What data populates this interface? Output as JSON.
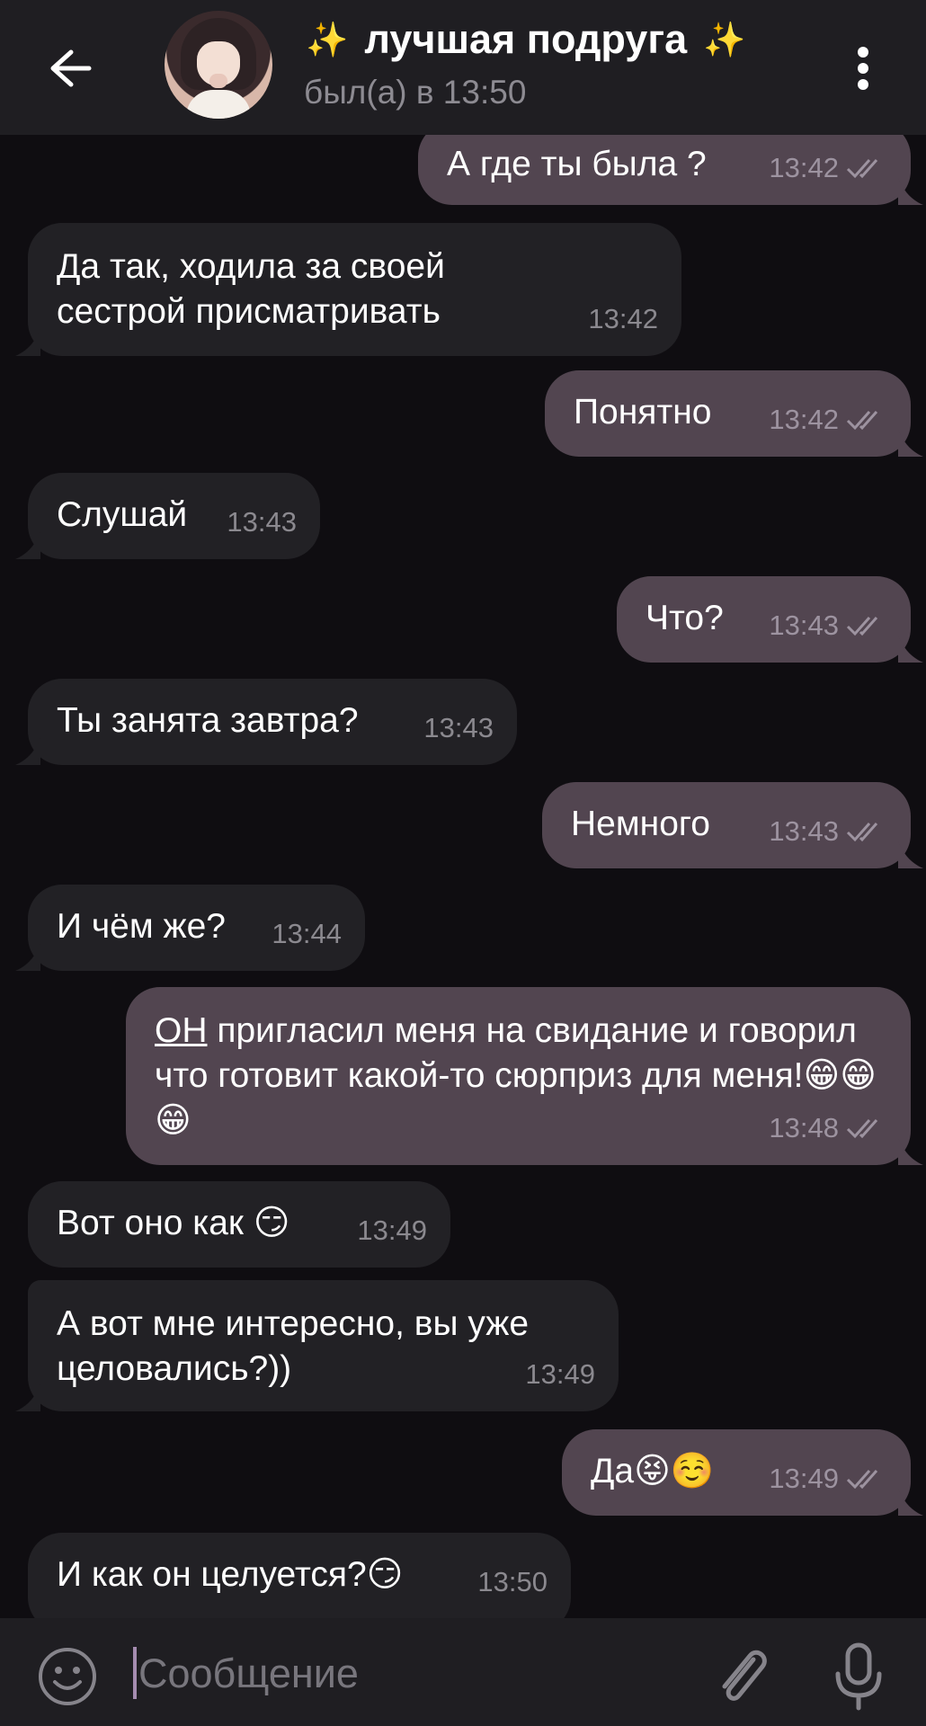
{
  "header": {
    "title": "лучшая подруга",
    "title_deco_left": "✨",
    "title_deco_right": "✨",
    "status": "был(а) в 13:50"
  },
  "messages": [
    {
      "dir": "out",
      "text": "А где ты была ?",
      "time": "13:42"
    },
    {
      "dir": "in",
      "text": "Да так, ходила за своей сестрой присматривать",
      "time": "13:42"
    },
    {
      "dir": "out",
      "text": "Понятно",
      "time": "13:42"
    },
    {
      "dir": "in",
      "text": "Слушай",
      "time": "13:43"
    },
    {
      "dir": "out",
      "text": "Что?",
      "time": "13:43"
    },
    {
      "dir": "in",
      "text": "Ты занята завтра?",
      "time": "13:43"
    },
    {
      "dir": "out",
      "text": "Немного",
      "time": "13:43"
    },
    {
      "dir": "in",
      "text": "И чём же?",
      "time": "13:44"
    },
    {
      "dir": "out",
      "text_underlined": "ОН",
      "text": "пригласил меня на свидание и говорил что готовит какой-то сюрприз для меня!😁😁😁",
      "time": "13:48"
    },
    {
      "dir": "in",
      "text": "Вот оно как 😏",
      "time": "13:49"
    },
    {
      "dir": "in",
      "text": "А вот мне интересно, вы уже целовались?))",
      "time": "13:49"
    },
    {
      "dir": "out",
      "text": "Да😝☺️",
      "time": "13:49"
    },
    {
      "dir": "in",
      "text": "И как он целуется?😏",
      "time": "13:50"
    }
  ],
  "composer": {
    "placeholder": "Сообщение"
  },
  "icons": {
    "back": "arrow-left-icon",
    "menu": "more-vertical-icon",
    "emoji": "smile-icon",
    "attach": "paperclip-icon",
    "mic": "microphone-icon",
    "read": "double-check-icon"
  }
}
